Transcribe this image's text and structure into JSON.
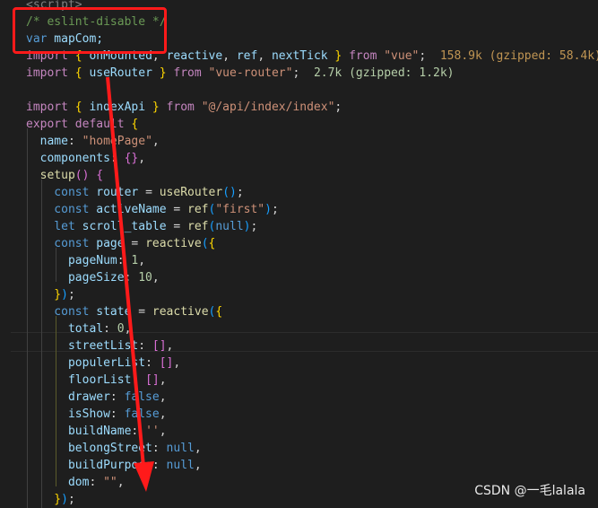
{
  "editor": {
    "lines": [
      {
        "n": "",
        "tokens": [
          {
            "t": "<script>",
            "c": "t-tag"
          }
        ]
      },
      {
        "n": "",
        "tokens": [
          {
            "t": "/* eslint-disable */",
            "c": "t-comment"
          }
        ]
      },
      {
        "n": "",
        "tokens": [
          {
            "t": "var",
            "c": "t-kw"
          },
          {
            "t": " mapCom;",
            "c": "t-var"
          }
        ]
      },
      {
        "n": "",
        "tokens": [
          {
            "t": "import",
            "c": "t-ctrl"
          },
          {
            "t": " { ",
            "c": "t-br1"
          },
          {
            "t": "onMounted",
            "c": "t-var"
          },
          {
            "t": ", ",
            "c": "t-punc"
          },
          {
            "t": "reactive",
            "c": "t-var"
          },
          {
            "t": ", ",
            "c": "t-punc"
          },
          {
            "t": "ref",
            "c": "t-var"
          },
          {
            "t": ", ",
            "c": "t-punc"
          },
          {
            "t": "nextTick",
            "c": "t-var"
          },
          {
            "t": " } ",
            "c": "t-br1"
          },
          {
            "t": "from",
            "c": "t-ctrl"
          },
          {
            "t": " \"vue\"",
            "c": "t-str"
          },
          {
            "t": ";  ",
            "c": "t-punc"
          },
          {
            "t": "158.9k (gzipped: 58.4k)",
            "c": "t-size"
          }
        ]
      },
      {
        "n": "",
        "tokens": [
          {
            "t": "import",
            "c": "t-ctrl"
          },
          {
            "t": " { ",
            "c": "t-br1"
          },
          {
            "t": "useRouter",
            "c": "t-var"
          },
          {
            "t": " } ",
            "c": "t-br1"
          },
          {
            "t": "from",
            "c": "t-ctrl"
          },
          {
            "t": " \"vue-router\"",
            "c": "t-str"
          },
          {
            "t": ";  ",
            "c": "t-punc"
          },
          {
            "t": "2.7k (gzipped: 1.2k)",
            "c": "t-size2"
          }
        ]
      },
      {
        "n": "",
        "tokens": []
      },
      {
        "n": "",
        "tokens": [
          {
            "t": "import",
            "c": "t-ctrl"
          },
          {
            "t": " { ",
            "c": "t-br1"
          },
          {
            "t": "indexApi",
            "c": "t-var"
          },
          {
            "t": " } ",
            "c": "t-br1"
          },
          {
            "t": "from",
            "c": "t-ctrl"
          },
          {
            "t": " \"@/api/index/index\"",
            "c": "t-str"
          },
          {
            "t": ";",
            "c": "t-punc"
          }
        ]
      },
      {
        "n": "",
        "tokens": [
          {
            "t": "export",
            "c": "t-ctrl"
          },
          {
            "t": " ",
            "c": "t-punc"
          },
          {
            "t": "default",
            "c": "t-ctrl"
          },
          {
            "t": " {",
            "c": "t-br1"
          }
        ]
      },
      {
        "n": "",
        "tokens": [
          {
            "t": "  name",
            "c": "t-var"
          },
          {
            "t": ": ",
            "c": "t-punc"
          },
          {
            "t": "\"homePage\"",
            "c": "t-str"
          },
          {
            "t": ",",
            "c": "t-punc"
          }
        ]
      },
      {
        "n": "",
        "tokens": [
          {
            "t": "  components",
            "c": "t-var"
          },
          {
            "t": ": ",
            "c": "t-punc"
          },
          {
            "t": "{}",
            "c": "t-br2"
          },
          {
            "t": ",",
            "c": "t-punc"
          }
        ]
      },
      {
        "n": "",
        "tokens": [
          {
            "t": "  setup",
            "c": "t-fn"
          },
          {
            "t": "() ",
            "c": "t-br2"
          },
          {
            "t": "{",
            "c": "t-br2"
          }
        ]
      },
      {
        "n": "",
        "tokens": [
          {
            "t": "    const",
            "c": "t-kw"
          },
          {
            "t": " router",
            "c": "t-var"
          },
          {
            "t": " = ",
            "c": "t-punc"
          },
          {
            "t": "useRouter",
            "c": "t-fn"
          },
          {
            "t": "()",
            "c": "t-br3"
          },
          {
            "t": ";",
            "c": "t-punc"
          }
        ]
      },
      {
        "n": "",
        "tokens": [
          {
            "t": "    const",
            "c": "t-kw"
          },
          {
            "t": " activeName",
            "c": "t-var"
          },
          {
            "t": " = ",
            "c": "t-punc"
          },
          {
            "t": "ref",
            "c": "t-fn"
          },
          {
            "t": "(",
            "c": "t-br3"
          },
          {
            "t": "\"first\"",
            "c": "t-str"
          },
          {
            "t": ")",
            "c": "t-br3"
          },
          {
            "t": ";",
            "c": "t-punc"
          }
        ]
      },
      {
        "n": "",
        "tokens": [
          {
            "t": "    let",
            "c": "t-kw"
          },
          {
            "t": " scroll_table",
            "c": "t-var"
          },
          {
            "t": " = ",
            "c": "t-punc"
          },
          {
            "t": "ref",
            "c": "t-fn"
          },
          {
            "t": "(",
            "c": "t-br3"
          },
          {
            "t": "null",
            "c": "t-kw"
          },
          {
            "t": ")",
            "c": "t-br3"
          },
          {
            "t": ";",
            "c": "t-punc"
          }
        ]
      },
      {
        "n": "",
        "tokens": [
          {
            "t": "    const",
            "c": "t-kw"
          },
          {
            "t": " page",
            "c": "t-var"
          },
          {
            "t": " = ",
            "c": "t-punc"
          },
          {
            "t": "reactive",
            "c": "t-fn"
          },
          {
            "t": "(",
            "c": "t-br3"
          },
          {
            "t": "{",
            "c": "t-br1"
          }
        ]
      },
      {
        "n": "",
        "tokens": [
          {
            "t": "      pageNum",
            "c": "t-var"
          },
          {
            "t": ": ",
            "c": "t-punc"
          },
          {
            "t": "1",
            "c": "t-num"
          },
          {
            "t": ",",
            "c": "t-punc"
          }
        ]
      },
      {
        "n": "",
        "tokens": [
          {
            "t": "      pageSize",
            "c": "t-var"
          },
          {
            "t": ": ",
            "c": "t-punc"
          },
          {
            "t": "10",
            "c": "t-num"
          },
          {
            "t": ",",
            "c": "t-punc"
          }
        ]
      },
      {
        "n": "",
        "tokens": [
          {
            "t": "    }",
            "c": "t-br1"
          },
          {
            "t": ")",
            "c": "t-br3"
          },
          {
            "t": ";",
            "c": "t-punc"
          }
        ]
      },
      {
        "n": "",
        "tokens": [
          {
            "t": "    const",
            "c": "t-kw"
          },
          {
            "t": " state",
            "c": "t-var"
          },
          {
            "t": " = ",
            "c": "t-punc"
          },
          {
            "t": "reactive",
            "c": "t-fn"
          },
          {
            "t": "(",
            "c": "t-br3"
          },
          {
            "t": "{",
            "c": "t-br1"
          }
        ]
      },
      {
        "n": "",
        "tokens": [
          {
            "t": "      total",
            "c": "t-var"
          },
          {
            "t": ": ",
            "c": "t-punc"
          },
          {
            "t": "0",
            "c": "t-num"
          },
          {
            "t": ",",
            "c": "t-punc"
          }
        ]
      },
      {
        "n": "",
        "tokens": [
          {
            "t": "      streetList",
            "c": "t-var"
          },
          {
            "t": ": ",
            "c": "t-punc"
          },
          {
            "t": "[]",
            "c": "t-br2"
          },
          {
            "t": ",",
            "c": "t-punc"
          }
        ]
      },
      {
        "n": "",
        "tokens": [
          {
            "t": "      populerList",
            "c": "t-var"
          },
          {
            "t": ": ",
            "c": "t-punc"
          },
          {
            "t": "[]",
            "c": "t-br2"
          },
          {
            "t": ",",
            "c": "t-punc"
          }
        ]
      },
      {
        "n": "",
        "tokens": [
          {
            "t": "      floorList",
            "c": "t-var"
          },
          {
            "t": ": ",
            "c": "t-punc"
          },
          {
            "t": "[]",
            "c": "t-br2"
          },
          {
            "t": ",",
            "c": "t-punc"
          }
        ]
      },
      {
        "n": "",
        "tokens": [
          {
            "t": "      drawer",
            "c": "t-var"
          },
          {
            "t": ": ",
            "c": "t-punc"
          },
          {
            "t": "false",
            "c": "t-kw"
          },
          {
            "t": ",",
            "c": "t-punc"
          }
        ]
      },
      {
        "n": "",
        "tokens": [
          {
            "t": "      isShow",
            "c": "t-var"
          },
          {
            "t": ": ",
            "c": "t-punc"
          },
          {
            "t": "false",
            "c": "t-kw"
          },
          {
            "t": ",",
            "c": "t-punc"
          }
        ]
      },
      {
        "n": "",
        "tokens": [
          {
            "t": "      buildName",
            "c": "t-var"
          },
          {
            "t": ": ",
            "c": "t-punc"
          },
          {
            "t": "''",
            "c": "t-str"
          },
          {
            "t": ",",
            "c": "t-punc"
          }
        ]
      },
      {
        "n": "",
        "tokens": [
          {
            "t": "      belongStreet",
            "c": "t-var"
          },
          {
            "t": ": ",
            "c": "t-punc"
          },
          {
            "t": "null",
            "c": "t-kw"
          },
          {
            "t": ",",
            "c": "t-punc"
          }
        ]
      },
      {
        "n": "",
        "tokens": [
          {
            "t": "      buildPurpose",
            "c": "t-var"
          },
          {
            "t": ": ",
            "c": "t-punc"
          },
          {
            "t": "null",
            "c": "t-kw"
          },
          {
            "t": ",",
            "c": "t-punc"
          }
        ]
      },
      {
        "n": "",
        "tokens": [
          {
            "t": "      dom",
            "c": "t-var"
          },
          {
            "t": ": ",
            "c": "t-punc"
          },
          {
            "t": "\"\"",
            "c": "t-str"
          },
          {
            "t": ",",
            "c": "t-punc"
          }
        ]
      },
      {
        "n": "",
        "tokens": [
          {
            "t": "    }",
            "c": "t-br1"
          },
          {
            "t": ")",
            "c": "t-br3"
          },
          {
            "t": ";",
            "c": "t-punc"
          }
        ]
      }
    ]
  },
  "watermark": "CSDN @一毛lalala",
  "annotation_color": "#ff1a1a"
}
